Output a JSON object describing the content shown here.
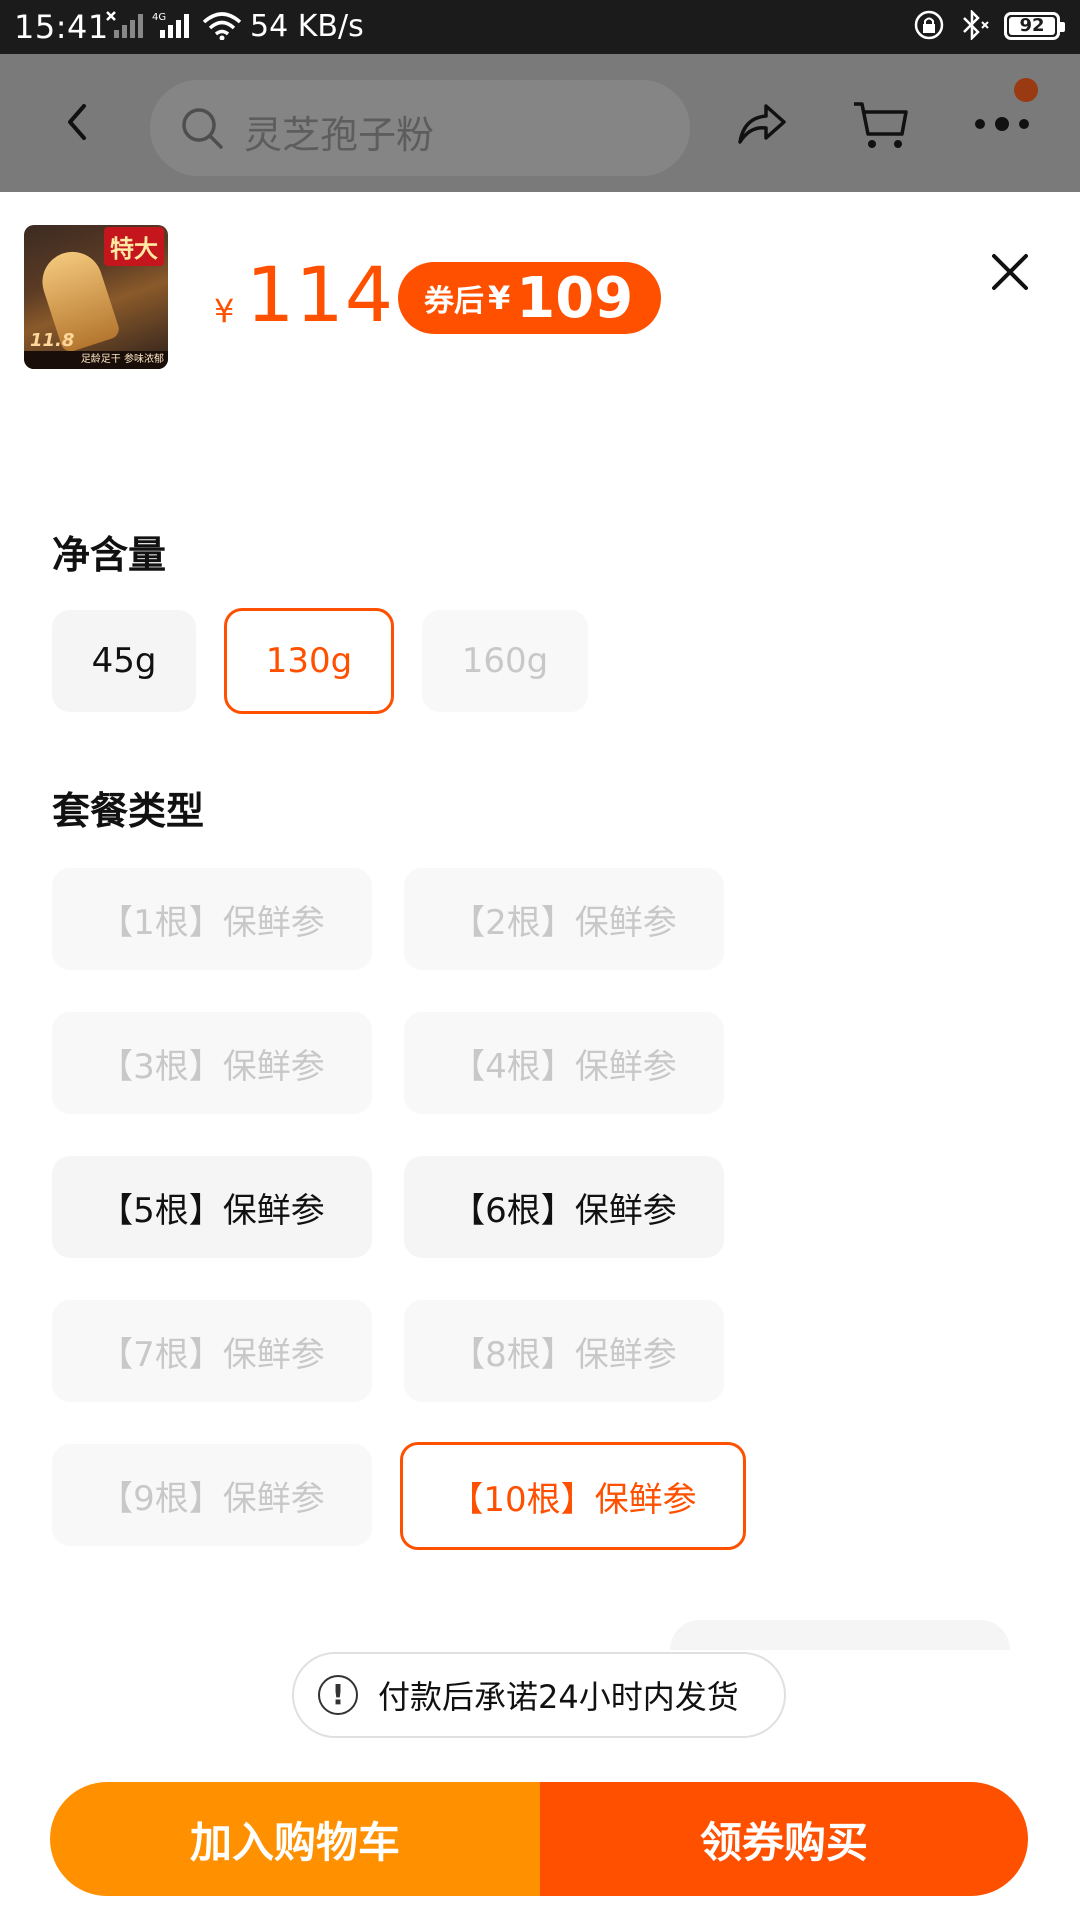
{
  "status_bar": {
    "time": "15:41",
    "network_type": "4G",
    "speed": "54 KB/s",
    "battery": "92"
  },
  "header": {
    "search_placeholder": "灵芝孢子粉",
    "icons": [
      "back-arrow-icon",
      "search-icon",
      "share-icon",
      "cart-icon",
      "more-icon"
    ]
  },
  "product": {
    "thumb_tag": "特大",
    "thumb_number": "11.8",
    "thumb_caption": "足龄足干 参味浓郁",
    "price_currency": "¥",
    "price": "114",
    "coupon_label": "券后",
    "coupon_currency": "¥",
    "coupon_price": "109"
  },
  "net_weight": {
    "title": "净含量",
    "options": [
      {
        "label": "45g",
        "state": "normal"
      },
      {
        "label": "130g",
        "state": "selected"
      },
      {
        "label": "160g",
        "state": "disabled"
      }
    ]
  },
  "package_type": {
    "title": "套餐类型",
    "options": [
      {
        "label": "【1根】保鲜参",
        "state": "disabled"
      },
      {
        "label": "【2根】保鲜参",
        "state": "disabled"
      },
      {
        "label": "【3根】保鲜参",
        "state": "disabled"
      },
      {
        "label": "【4根】保鲜参",
        "state": "disabled"
      },
      {
        "label": "【5根】保鲜参",
        "state": "normal"
      },
      {
        "label": "【6根】保鲜参",
        "state": "normal"
      },
      {
        "label": "【7根】保鲜参",
        "state": "disabled"
      },
      {
        "label": "【8根】保鲜参",
        "state": "disabled"
      },
      {
        "label": "【9根】保鲜参",
        "state": "disabled"
      },
      {
        "label": "【10根】保鲜参",
        "state": "selected"
      }
    ]
  },
  "notice": {
    "text": "付款后承诺24小时内发货"
  },
  "actions": {
    "add_to_cart": "加入购物车",
    "buy_with_coupon": "领券购买"
  },
  "colors": {
    "accent": "#ff5000",
    "cart_button": "#ff9000",
    "chip_bg": "#f5f5f5",
    "disabled_text": "#c8c8c8"
  }
}
